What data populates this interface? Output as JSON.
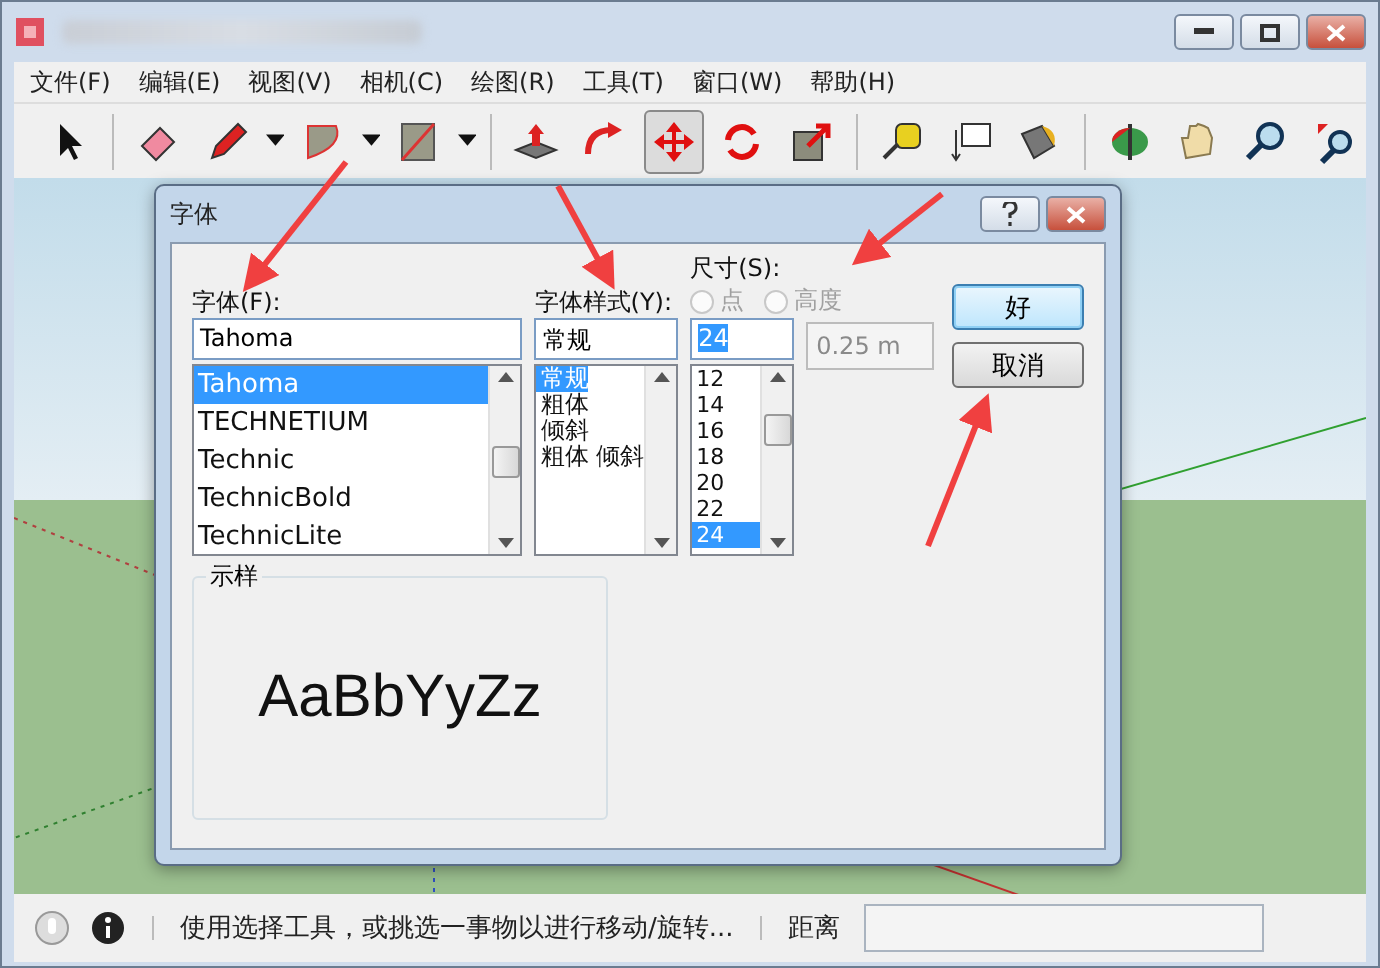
{
  "menu": [
    "文件(F)",
    "编辑(E)",
    "视图(V)",
    "相机(C)",
    "绘图(R)",
    "工具(T)",
    "窗口(W)",
    "帮助(H)"
  ],
  "toolbar": [
    {
      "kind": "select",
      "selected": false
    },
    {
      "kind": "sep"
    },
    {
      "kind": "eraser",
      "selected": false
    },
    {
      "kind": "pencil",
      "selected": false
    },
    {
      "kind": "dropdown"
    },
    {
      "kind": "arc",
      "selected": false
    },
    {
      "kind": "dropdown"
    },
    {
      "kind": "rect",
      "selected": false
    },
    {
      "kind": "dropdown"
    },
    {
      "kind": "sep"
    },
    {
      "kind": "pushpull",
      "selected": false
    },
    {
      "kind": "followme",
      "selected": false
    },
    {
      "kind": "move",
      "selected": true
    },
    {
      "kind": "rotate",
      "selected": false
    },
    {
      "kind": "scale",
      "selected": false
    },
    {
      "kind": "sep"
    },
    {
      "kind": "tape",
      "selected": false
    },
    {
      "kind": "text",
      "selected": false
    },
    {
      "kind": "paint",
      "selected": false
    },
    {
      "kind": "sep"
    },
    {
      "kind": "orbit",
      "selected": false
    },
    {
      "kind": "pan",
      "selected": false
    },
    {
      "kind": "zoom",
      "selected": false
    },
    {
      "kind": "zoomext",
      "selected": false
    }
  ],
  "dialog": {
    "title": "字体",
    "font": {
      "label": "字体(F):",
      "value": "Tahoma",
      "items": [
        {
          "text": "Tahoma",
          "selected": true
        },
        {
          "text": "TECHNETIUM",
          "selected": false
        },
        {
          "text": "Technic",
          "selected": false
        },
        {
          "text": "TechnicBold",
          "selected": false
        },
        {
          "text": "TechnicLite",
          "selected": false
        }
      ]
    },
    "style": {
      "label": "字体样式(Y):",
      "value": "常规",
      "items": [
        {
          "text": "常规",
          "selected": true
        },
        {
          "text": "粗体",
          "selected": false
        },
        {
          "text": "倾斜",
          "selected": false
        },
        {
          "text": "粗体 倾斜",
          "selected": false
        }
      ]
    },
    "size": {
      "label": "尺寸(S):",
      "value": "24",
      "radios": [
        {
          "label": "点",
          "checked": false,
          "disabled": true
        },
        {
          "label": "高度",
          "checked": false,
          "disabled": true
        }
      ],
      "height_value": "0.25 m",
      "height_disabled": true,
      "items": [
        {
          "text": "12",
          "selected": false
        },
        {
          "text": "14",
          "selected": false
        },
        {
          "text": "16",
          "selected": false
        },
        {
          "text": "18",
          "selected": false
        },
        {
          "text": "20",
          "selected": false
        },
        {
          "text": "22",
          "selected": false
        },
        {
          "text": "24",
          "selected": true
        }
      ]
    },
    "sample": {
      "label": "示样",
      "text": "AaBbYyZz"
    },
    "buttons": [
      {
        "label": "好",
        "default": true
      },
      {
        "label": "取消",
        "default": false
      }
    ]
  },
  "status_bar": {
    "message": "使用选择工具，或挑选一事物以进行移动/旋转...",
    "measure_label": "距离"
  }
}
